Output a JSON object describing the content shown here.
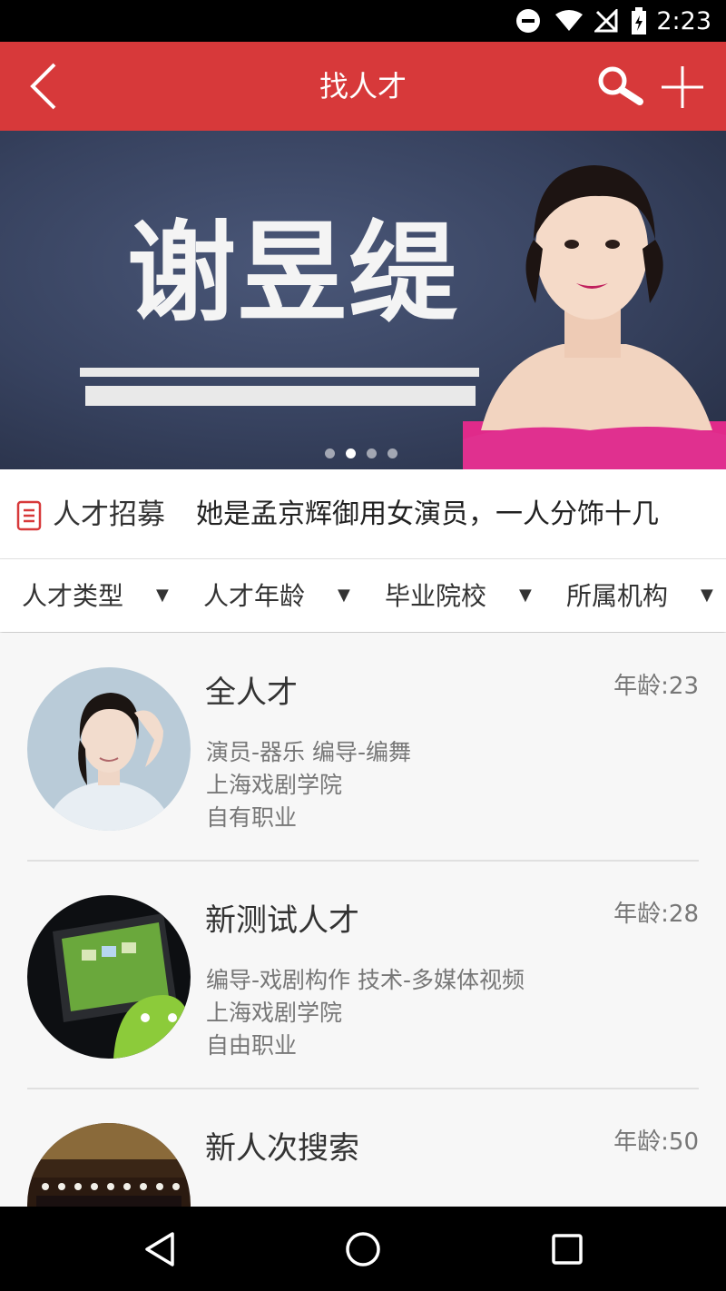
{
  "status": {
    "time": "2:23"
  },
  "app_bar": {
    "title": "找人才"
  },
  "banner": {
    "title": "谢昱缇",
    "slide_count": 4,
    "active_slide": 2
  },
  "notice": {
    "label": "人才招募",
    "text": "她是孟京辉御用女演员，一人分饰十几"
  },
  "filters": [
    {
      "label": "人才类型"
    },
    {
      "label": "人才年龄"
    },
    {
      "label": "毕业院校"
    },
    {
      "label": "所属机构"
    }
  ],
  "talents": [
    {
      "name": "全人才",
      "age": "年龄:23",
      "roles": "演员-器乐 编导-编舞",
      "school": "上海戏剧学院",
      "status": "自有职业"
    },
    {
      "name": "新测试人才",
      "age": "年龄:28",
      "roles": "编导-戏剧构作 技术-多媒体视频",
      "school": "上海戏剧学院",
      "status": "自由职业"
    },
    {
      "name": "新人次搜索",
      "age": "年龄:50"
    }
  ]
}
